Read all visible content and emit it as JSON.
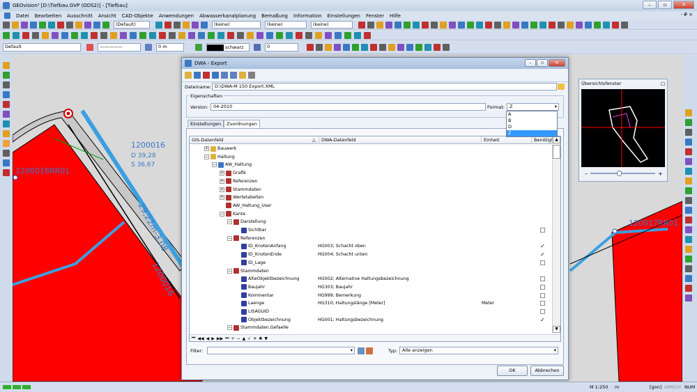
{
  "app": {
    "title": "GEOvision³ [D:\\Tiefbau.GVP (ODS2)] - [Tiefbau]",
    "window_buttons": [
      "–",
      "▫",
      "✕"
    ],
    "child_window_buttons": "- ₽ ×"
  },
  "menu": [
    "Datei",
    "Bearbeiten",
    "Ausschnitt",
    "Ansicht",
    "CAD-Objekte",
    "Anwendungen",
    "Abwasserkanalplanung",
    "Bemaßung",
    "Information",
    "Einstellungen",
    "Fenster",
    "Hilfe"
  ],
  "toolbar2": {
    "combo1": "(Default)",
    "combo2": "(keine)",
    "combo3": "(keine)",
    "combo4": "(keine)"
  },
  "toolbar3": {
    "layer": "Default",
    "linetype": "—————",
    "width": "0 m",
    "color": "schwarz",
    "number": "0"
  },
  "drawing": {
    "labels": [
      {
        "text": "1200016"
      },
      {
        "text": "D 39,28"
      },
      {
        "text": "S 36,67"
      },
      {
        "text": "1200018RR01"
      },
      {
        "text": "29,22m-3,08"
      },
      {
        "text": "1200016"
      },
      {
        "text": "120017RR01"
      }
    ]
  },
  "overview": {
    "title": "Übersichtsfenster",
    "close": "□",
    "zoom_minus": "–",
    "zoom_plus": "+"
  },
  "dialog": {
    "title": "DWA - Export",
    "dateiname_label": "Dateiname:",
    "dateiname_value": "D:\\DWA-M 150 Export.XML",
    "eigenschaften_label": "Eigenschaften",
    "version_label": "Version:",
    "version_value": "04-2010",
    "format_label": "Format:",
    "format_value": "Z",
    "format_options": [
      "A",
      "B",
      "D",
      "Z"
    ],
    "tabs": [
      "Einstellungen",
      "Zuordnungen"
    ],
    "columns": [
      "GIS-Datenfeld",
      "DWA-Datenfeld",
      "Einheit",
      "Benötigt"
    ],
    "rows": [
      {
        "label": "Bauwerk",
        "level": 1,
        "exp": "+",
        "dwa": "",
        "einheit": "",
        "chk": ""
      },
      {
        "label": "Haltung",
        "level": 1,
        "exp": "-",
        "dwa": "",
        "einheit": "",
        "chk": ""
      },
      {
        "label": "AW_Haltung",
        "level": 2,
        "exp": "-",
        "dwa": "",
        "einheit": "",
        "chk": ""
      },
      {
        "label": "Grafik",
        "level": 3,
        "exp": "+",
        "dwa": "",
        "einheit": "",
        "chk": ""
      },
      {
        "label": "Referenzen",
        "level": 3,
        "exp": "+",
        "dwa": "",
        "einheit": "",
        "chk": ""
      },
      {
        "label": "Stammdaten",
        "level": 3,
        "exp": "+",
        "dwa": "",
        "einheit": "",
        "chk": ""
      },
      {
        "label": "Wertetabellen",
        "level": 3,
        "exp": "+",
        "dwa": "",
        "einheit": "",
        "chk": ""
      },
      {
        "label": "AW_Haltung_User",
        "level": 3,
        "exp": "",
        "dwa": "",
        "einheit": "",
        "chk": ""
      },
      {
        "label": "Kante",
        "level": 3,
        "exp": "-",
        "dwa": "",
        "einheit": "",
        "chk": ""
      },
      {
        "label": "Darstellung",
        "level": 4,
        "exp": "-",
        "dwa": "",
        "einheit": "",
        "chk": ""
      },
      {
        "label": "Sichtbar",
        "level": 5,
        "exp": "",
        "dwa": "",
        "einheit": "",
        "chk": "box"
      },
      {
        "label": "Referenzen",
        "level": 4,
        "exp": "-",
        "dwa": "",
        "einheit": "",
        "chk": ""
      },
      {
        "label": "ID_KnotenAnfang",
        "level": 5,
        "exp": "",
        "dwa": "HG003; Schacht oben",
        "einheit": "",
        "chk": "checked"
      },
      {
        "label": "ID_KnotenEnde",
        "level": 5,
        "exp": "",
        "dwa": "HG004; Schacht unten",
        "einheit": "",
        "chk": "checked"
      },
      {
        "label": "ID_Lage",
        "level": 5,
        "exp": "",
        "dwa": "",
        "einheit": "",
        "chk": "box"
      },
      {
        "label": "Stammdaten",
        "level": 4,
        "exp": "-",
        "dwa": "",
        "einheit": "",
        "chk": ""
      },
      {
        "label": "AlteObjektbezeichnung",
        "level": 5,
        "exp": "",
        "dwa": "HG002; Alternative Haltungsbezeichnung",
        "einheit": "",
        "chk": "box"
      },
      {
        "label": "Baujahr",
        "level": 5,
        "exp": "",
        "dwa": "HG303; Baujahr",
        "einheit": "",
        "chk": "box"
      },
      {
        "label": "Kommentar",
        "level": 5,
        "exp": "",
        "dwa": "HG999; Bemerkung",
        "einheit": "",
        "chk": "box"
      },
      {
        "label": "Laenge",
        "level": 5,
        "exp": "",
        "dwa": "HG310; Haltungslänge [Meter]",
        "einheit": "Meter",
        "chk": "box"
      },
      {
        "label": "LISAGUID",
        "level": 5,
        "exp": "",
        "dwa": "",
        "einheit": "",
        "chk": "box"
      },
      {
        "label": "Objektbezeichnung",
        "level": 5,
        "exp": "",
        "dwa": "HG001; Haltungsbezeichnung",
        "einheit": "",
        "chk": "checked"
      },
      {
        "label": "Stammdaten.Gefaelle",
        "level": 4,
        "exp": "-",
        "dwa": "",
        "einheit": "",
        "chk": ""
      }
    ],
    "filter_label": "Filter:",
    "typ_label": "Typ:",
    "typ_value": "Alle anzeigen",
    "ok_label": "OK",
    "cancel_label": "Abbrechen"
  },
  "status": {
    "scale": "M 1:250",
    "unit": "m",
    "angle": "[gon]",
    "umsch": "UMSCH",
    "num": "NUM"
  }
}
